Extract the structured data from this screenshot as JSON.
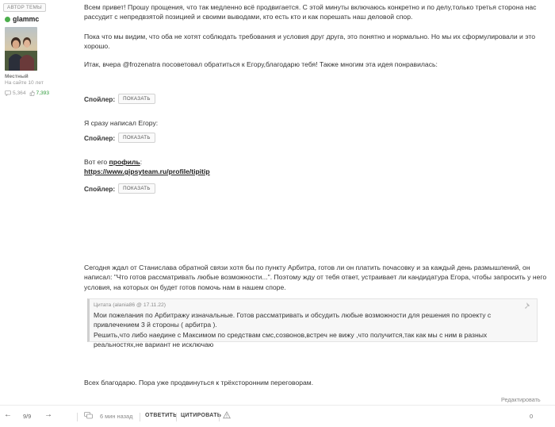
{
  "author": {
    "badge": "АВТОР ТЕМЫ",
    "name": "glammc",
    "rank": "Местный",
    "last_seen": "На сайте 10 лет",
    "posts": "5,364",
    "reputation": "7,393",
    "online_color": "#4cae4c"
  },
  "post": {
    "p1": "Всем привет! Прошу прощения, что так медленно всё продвигается. С этой минуты включаюсь конкретно и по делу,только третья сторона нас рассудит с непредвзятой позицией и своими выводами, кто есть кто и как порешать наш деловой спор.",
    "p2": "Пока что мы видим, что оба не хотят соблюдать требования и условия друг друга, это понятно и нормально. Но мы их сформулировали и это хорошо.",
    "p3": "Итак, вчера @frozenatra посоветовал обратиться к Егору,благодарю тебя! Также многим эта идея понравилась:",
    "spoiler_label": "Спойлер:",
    "spoiler_button": "ПОКАЗАТЬ",
    "p4": "Я сразу написал Егору:",
    "p5_prefix": "Вот его ",
    "p5_link": "профиль",
    "p5_suffix": ":",
    "profile_url": "https://www.gipsyteam.ru/profile/tipitip",
    "p6": "Сегодня ждал от Станислава обратной связи хотя бы по пункту Арбитра, готов ли он платить почасовку и за каждый день размышлений, он написал: \"Что готов рассматривать любые возможности...\". Поэтому жду от тебя ответ, устраивает ли кандидатура Егора, чтобы запросить у него условия, на которых он будет готов помочь нам в нашем споре.",
    "p7": "Всех благодарю. Пора уже продвинуться к трёхсторонним переговорам."
  },
  "quote": {
    "header": "Цитата (alania86 @ 17.11.22)",
    "text1": "Мои пожелания по Арбитражу изначальные. Готов рассматривать и обсудить любые возможности для решения по проекту с привлечением 3 й стороны ( арбитра ).",
    "text2": "Решить,что либо наедине с Максимом по средствам смс,созвонов,встреч не вижу ,что получится,так как мы с ним в разных реальностях,не вариант не исключаю"
  },
  "edit_label": "Редактировать",
  "footer": {
    "prev_arrow": "←",
    "counter": "9/9",
    "next_arrow": "→",
    "time": "6 мин назад",
    "reply": "ОТВЕТИТЬ",
    "cite": "ЦИТИРОВАТЬ",
    "likes": "0"
  }
}
